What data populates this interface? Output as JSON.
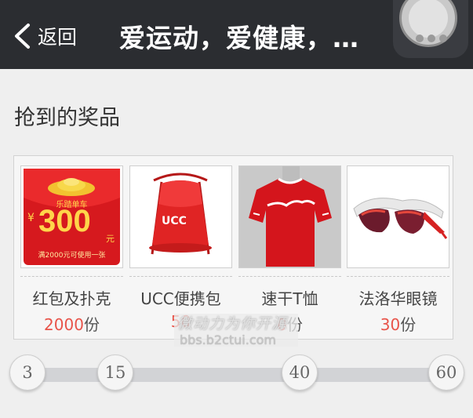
{
  "header": {
    "back_label": "返回",
    "title": "爱运动，爱健康，…"
  },
  "section": {
    "title": "抢到的奖品"
  },
  "prizes": [
    {
      "name": "红包及扑克",
      "count": "2000",
      "unit": "份",
      "envelope": {
        "brand": "乐踏单车",
        "yen": "¥",
        "amount": "300",
        "yuan": "元",
        "note": "满2000元可使用一张"
      }
    },
    {
      "name": "UCC便携包",
      "count": "50",
      "unit": "",
      "bag_brand": "UCC"
    },
    {
      "name": "速干T恤",
      "count": "0",
      "unit": "份"
    },
    {
      "name": "法洛华眼镜",
      "count": "30",
      "unit": "份"
    }
  ],
  "progress": {
    "milestones": [
      "3",
      "15",
      "40",
      "60"
    ]
  },
  "watermark": {
    "line1": "微动力为你开源",
    "line2": "bbs.b2ctui.com"
  },
  "colors": {
    "header_bg": "#2b2d31",
    "accent_red": "#e8544a",
    "background": "#efefef"
  }
}
